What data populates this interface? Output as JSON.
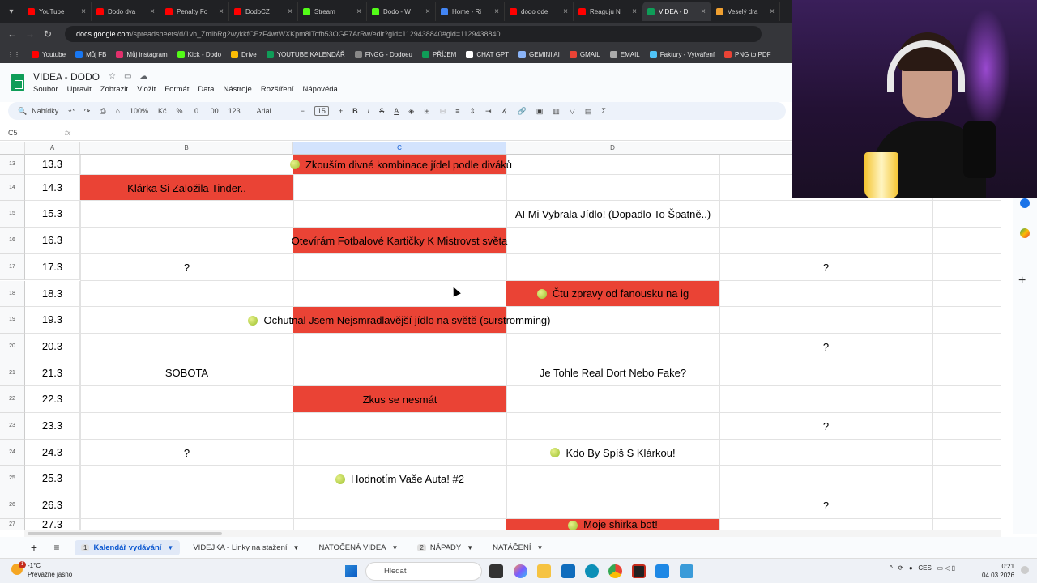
{
  "browser": {
    "tabs": [
      {
        "label": "YouTube",
        "color": "#ff0000",
        "active": false
      },
      {
        "label": "Dodo dva",
        "color": "#ff0000",
        "active": false
      },
      {
        "label": "Penalty Fo",
        "color": "#ff0000",
        "active": false
      },
      {
        "label": "DodoCZ",
        "color": "#ff0000",
        "active": false
      },
      {
        "label": "Stream",
        "color": "#53fc18",
        "active": false
      },
      {
        "label": "Dodo - W",
        "color": "#53fc18",
        "active": false
      },
      {
        "label": "Home - Ri",
        "color": "#4285f4",
        "active": false
      },
      {
        "label": "dodo ode",
        "color": "#ff0000",
        "active": false
      },
      {
        "label": "Reaguju N",
        "color": "#ff0000",
        "active": false
      },
      {
        "label": "VIDEA - D",
        "color": "#0f9d58",
        "active": true
      },
      {
        "label": "Veselý dra",
        "color": "#f0a030",
        "active": false
      }
    ],
    "url_host": "docs.google.com",
    "url_path": "/spreadsheets/d/1vh_ZmlbRg2wykkfCEzF4wtWXKpm8ITcfb53OGF7ArRw/edit?gid=1129438840#gid=1129438840",
    "bookmarks": [
      {
        "label": "Youtube",
        "color": "#ff0000"
      },
      {
        "label": "Můj FB",
        "color": "#1877f2"
      },
      {
        "label": "Můj instagram",
        "color": "#e1306c"
      },
      {
        "label": "Kick - Dodo",
        "color": "#53fc18"
      },
      {
        "label": "Drive",
        "color": "#fbbc04"
      },
      {
        "label": "YOUTUBE KALENDÁŘ",
        "color": "#0f9d58"
      },
      {
        "label": "FNGG - Dodoeu",
        "color": "#888888"
      },
      {
        "label": "PŘÍJEM",
        "color": "#0f9d58"
      },
      {
        "label": "CHAT GPT",
        "color": "#ffffff"
      },
      {
        "label": "GEMINI AI",
        "color": "#8ab4f8"
      },
      {
        "label": "GMAIL",
        "color": "#ea4335"
      },
      {
        "label": "EMAIL",
        "color": "#aaaaaa"
      },
      {
        "label": "Faktury - Vytváření",
        "color": "#4fc3f7"
      },
      {
        "label": "PNG to PDF",
        "color": "#ea4335"
      }
    ]
  },
  "app": {
    "title": "VIDEA - DODO",
    "menus": [
      "Soubor",
      "Upravit",
      "Zobrazit",
      "Vložit",
      "Formát",
      "Data",
      "Nástroje",
      "Rozšíření",
      "Nápověda"
    ],
    "toolbar": {
      "search": "Nabídky",
      "zoom": "100%",
      "currency": "Kč",
      "percent": "%",
      "dec_minus": ".0",
      "dec_plus": ".00",
      "number": "123",
      "font": "Arial",
      "font_size": "15",
      "bold": "B",
      "italic": "I",
      "strike": "S",
      "text_color": "A",
      "sum": "Σ"
    },
    "cell_ref": "C5",
    "fx": "fx"
  },
  "sheet": {
    "columns": [
      "A",
      "B",
      "C",
      "D"
    ],
    "rows": [
      {
        "num": "13",
        "a": "13.3"
      },
      {
        "num": "14",
        "a": "14.3"
      },
      {
        "num": "15",
        "a": "15.3"
      },
      {
        "num": "16",
        "a": "16.3"
      },
      {
        "num": "17",
        "a": "17.3"
      },
      {
        "num": "18",
        "a": "18.3"
      },
      {
        "num": "19",
        "a": "19.3"
      },
      {
        "num": "20",
        "a": "20.3"
      },
      {
        "num": "21",
        "a": "21.3"
      },
      {
        "num": "22",
        "a": "22.3"
      },
      {
        "num": "23",
        "a": "23.3"
      },
      {
        "num": "24",
        "a": "24.3"
      },
      {
        "num": "25",
        "a": "25.3"
      },
      {
        "num": "26",
        "a": "26.3"
      },
      {
        "num": "27",
        "a": "27.3"
      }
    ],
    "cells": {
      "r13c": "Zkouším divné kombinace jídel podle diváků",
      "r14b": "Klárka Si Založila Tinder..",
      "r15d": "AI Mi Vybrala Jídlo! (Dopadlo To Špatně..)",
      "r16c": "Otevírám Fotbalové Kartičky K Mistrovst světa",
      "r17b": "?",
      "r17e": "?",
      "r18d": "Čtu zpravy od fanousku na ig",
      "r19c": "Ochutnal Jsem Nejsmradlavější jídlo na světě (surstromming)",
      "r20e": "?",
      "r21b": "SOBOTA",
      "r21d": "Je Tohle Real Dort Nebo Fake?",
      "r22c": "Zkus se nesmát",
      "r23e": "?",
      "r24b": "?",
      "r24d": "Kdo By Spíš S Klárkou!",
      "r25c": "Hodnotím Vaše Auta! #2",
      "r26e": "?",
      "r27d": "Moje shirka bot!"
    },
    "cell_fill": "#ea4335"
  },
  "sheet_tabs": [
    {
      "num": "1",
      "label": "Kalendář vydávání",
      "active": true
    },
    {
      "num": "",
      "label": "VIDEJKA - Linky na stažení",
      "active": false
    },
    {
      "num": "",
      "label": "NATOČENÁ VIDEA",
      "active": false
    },
    {
      "num": "2",
      "label": "NÁPADY",
      "active": false
    },
    {
      "num": "",
      "label": "NATÁČENÍ",
      "active": false
    }
  ],
  "taskbar": {
    "weather_temp": "-1°C",
    "weather_desc": "Převážně jasno",
    "weather_badge": "1",
    "search_placeholder": "Hledat",
    "language": "CES",
    "time": "0:21",
    "date": "04.03.2026"
  }
}
